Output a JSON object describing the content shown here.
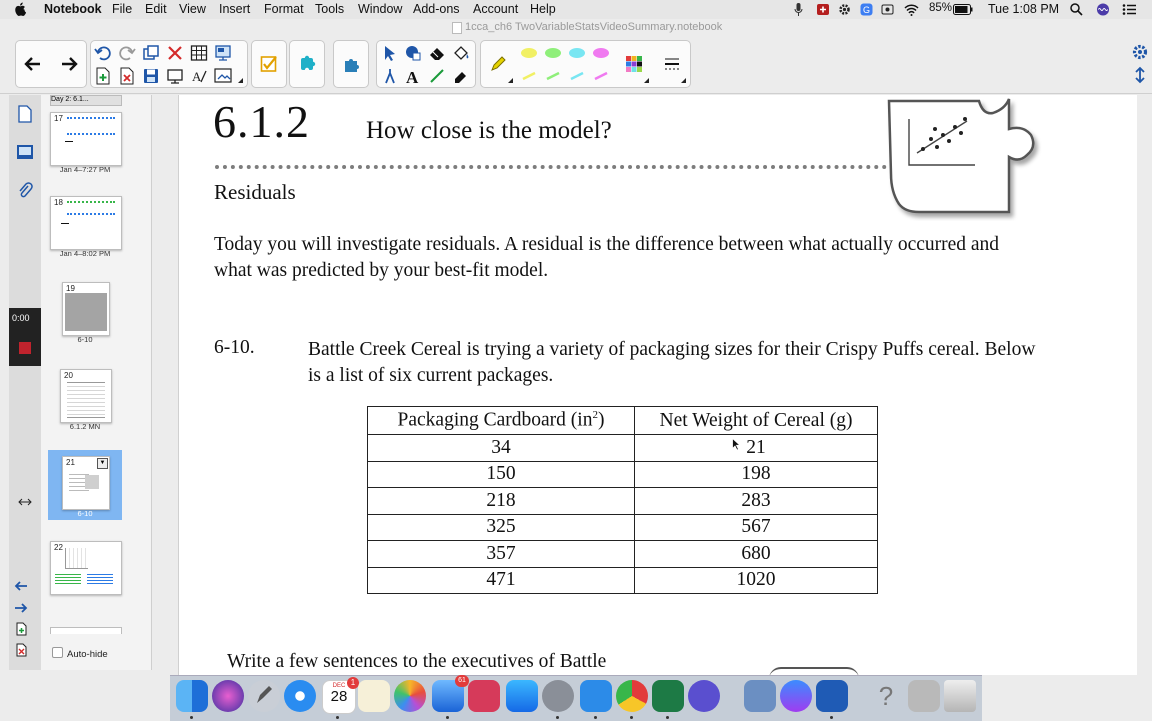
{
  "menubar": {
    "app_name": "Notebook",
    "items": [
      "File",
      "Edit",
      "View",
      "Insert",
      "Format",
      "Tools",
      "Window",
      "Add-ons",
      "Account",
      "Help"
    ],
    "battery": "85%",
    "clock": "Tue 1:08 PM"
  },
  "window": {
    "document_title": "1cca_ch6 TwoVariableStatsVideoSummary.notebook"
  },
  "sidebar": {
    "recording_time": "0:00",
    "header_label": "Day 2: 6.1...",
    "pages": [
      {
        "number": "17",
        "label": "Jan 4–7:27 PM",
        "selected": false
      },
      {
        "number": "18",
        "label": "Jan 4–8:02 PM",
        "selected": false
      },
      {
        "number": "19",
        "label": "6-10",
        "selected": false
      },
      {
        "number": "20",
        "label": "6.1.2 MN",
        "selected": false
      },
      {
        "number": "21",
        "label": "6-10",
        "selected": true
      },
      {
        "number": "22",
        "label": "",
        "selected": false
      }
    ],
    "auto_hide_label": "Auto-hide"
  },
  "page": {
    "lesson_number": "6.1.2",
    "lesson_title": "How close is the model?",
    "section_heading": "Residuals",
    "intro": "Today you will investigate residuals.  A residual is the difference between what actually occurred and what was predicted by your best-fit model.",
    "problem_number": "6-10.",
    "problem_text": "Battle Creek Cereal is trying a variety of packaging sizes for their Crispy Puffs cereal.  Below is a list of six current packages.",
    "table": {
      "header_1": "Packaging Cardboard (in",
      "header_1_sup": "2",
      "header_1_end": ")",
      "header_2": "Net Weight of Cereal (g)",
      "rows": [
        [
          "34",
          "21"
        ],
        [
          "150",
          "198"
        ],
        [
          "218",
          "283"
        ],
        [
          "325",
          "567"
        ],
        [
          "357",
          "680"
        ],
        [
          "471",
          "1020"
        ]
      ]
    },
    "followup": "Write a few sentences to the executives of Battle"
  },
  "dock": {
    "calendar_month": "DEC",
    "calendar_day": "28",
    "calendar_badge": "1",
    "mail_badge": "61"
  }
}
